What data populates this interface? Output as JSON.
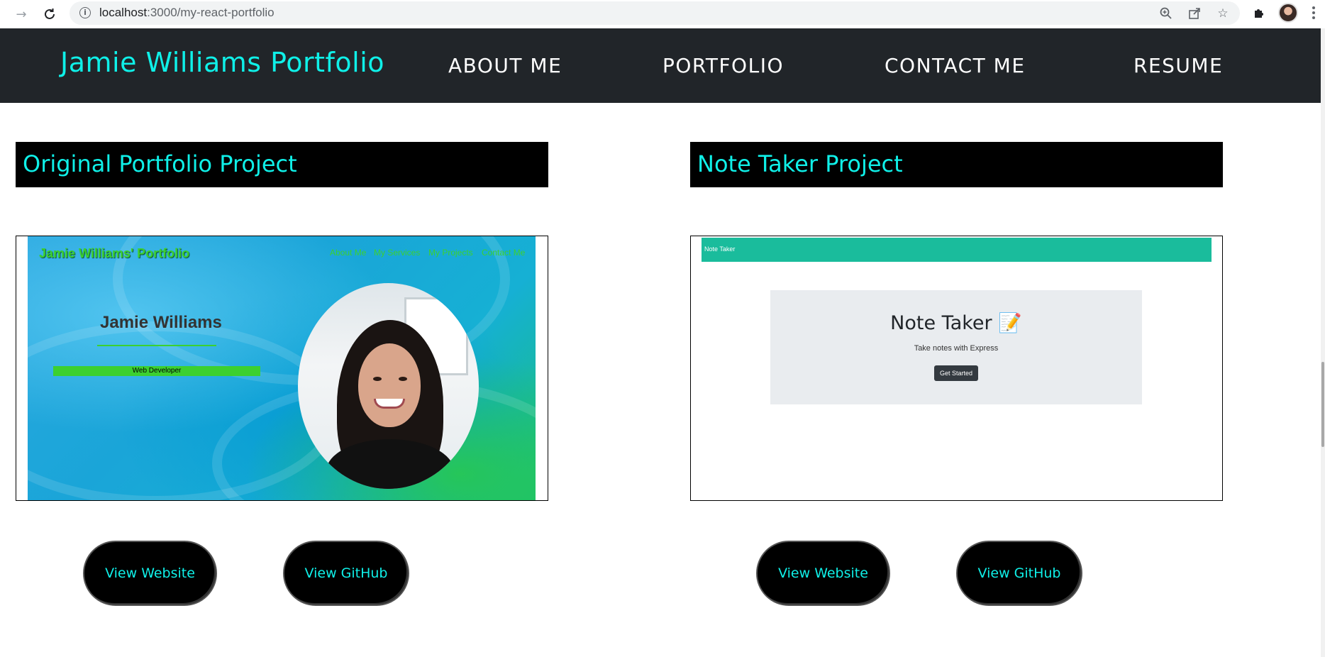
{
  "browser": {
    "url_host": "localhost",
    "url_path": ":3000/my-react-portfolio",
    "icons": [
      "forward-icon",
      "reload-icon",
      "site-info-icon",
      "zoom-icon",
      "share-icon",
      "bookmark-star-icon",
      "extensions-icon",
      "profile-avatar",
      "menu-icon"
    ]
  },
  "header": {
    "brand": "Jamie Williams Portfolio",
    "nav": [
      "ABOUT ME",
      "PORTFOLIO",
      "CONTACT ME",
      "RESUME"
    ]
  },
  "projects": [
    {
      "title": "Original Portfolio Project",
      "screenshot": {
        "brand": "Jamie Williams' Portfolio",
        "nav": [
          "About Me",
          "My Services",
          "My Projects",
          "Contact Me"
        ],
        "name": "Jamie Williams",
        "role": "Web Developer"
      },
      "website_label": "View Website",
      "github_label": "View GitHub"
    },
    {
      "title": "Note Taker Project",
      "screenshot": {
        "bar_title": "Note Taker",
        "heading": "Note Taker 📝",
        "subtitle": "Take notes with Express",
        "button": "Get Started"
      },
      "website_label": "View Website",
      "github_label": "View GitHub"
    }
  ],
  "colors": {
    "accent": "#0ff0e8",
    "header_bg": "#212529",
    "card_title_bg": "#000000",
    "note_taker_bar": "#1abc9c"
  }
}
